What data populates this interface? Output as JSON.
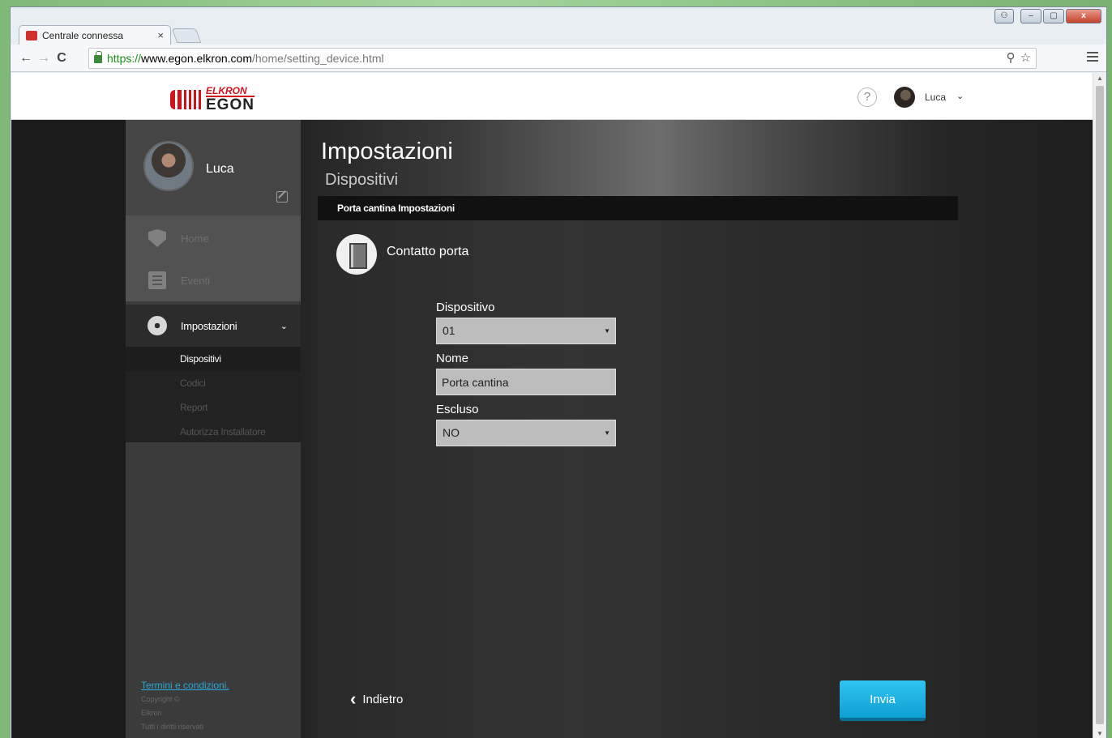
{
  "browser": {
    "tab_title": "Centrale connessa",
    "tab_close": "×",
    "url_scheme": "https://",
    "url_host": "www.egon.elkron.com",
    "url_path": "/home/setting_device.html"
  },
  "header": {
    "logo_brand_top": "ELKRON",
    "logo_brand_bottom": "EGON",
    "help_label": "?",
    "user_name": "Luca"
  },
  "sidebar": {
    "profile_name": "Luca",
    "nav": {
      "home": "Home",
      "events": "Eventi",
      "settings": "Impostazioni"
    },
    "subnav": [
      "Dispositivi",
      "Codici",
      "Report",
      "Autorizza Installatore"
    ],
    "footer": {
      "terms": "Termini e condizioni.",
      "copyright": "Copyright ©",
      "company": "Elkron",
      "rights": "Tutti i diritti riservati"
    }
  },
  "main": {
    "title": "Impostazioni",
    "subtitle": "Dispositivi",
    "panel_title": "Porta cantina Impostazioni",
    "device_name": "Contatto porta",
    "fields": {
      "device_label": "Dispositivo",
      "device_value": "01",
      "name_label": "Nome",
      "name_value": "Porta cantina",
      "excluded_label": "Escluso",
      "excluded_value": "NO"
    },
    "back_label": "Indietro",
    "send_label": "Invia"
  }
}
